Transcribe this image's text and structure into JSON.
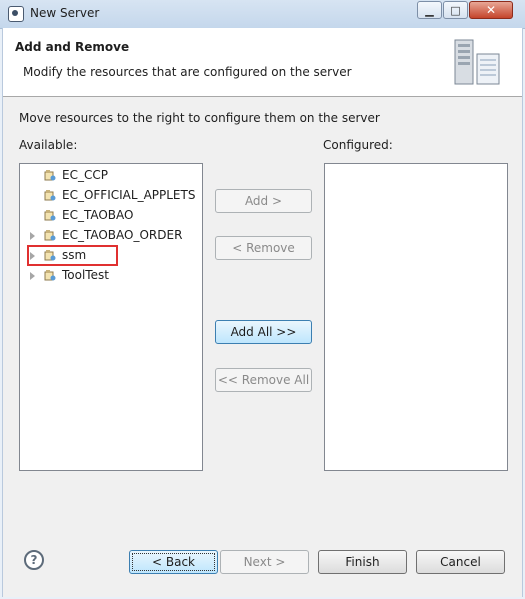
{
  "window": {
    "title": "New Server",
    "minimize_label": "▁",
    "maximize_label": "□",
    "close_label": "✕",
    "app_icon": "eclipse-icon"
  },
  "header": {
    "title": "Add and Remove",
    "subtitle": "Modify the resources that are configured on the server",
    "icon": "server-icon"
  },
  "instruction": "Move resources to the right to configure them on the server",
  "available": {
    "label": "Available:",
    "items": [
      {
        "label": "EC_CCP",
        "expandable": false
      },
      {
        "label": "EC_OFFICIAL_APPLETS",
        "expandable": false
      },
      {
        "label": "EC_TAOBAO",
        "expandable": false
      },
      {
        "label": "EC_TAOBAO_ORDER",
        "expandable": true
      },
      {
        "label": "ssm",
        "expandable": true,
        "highlighted": true
      },
      {
        "label": "ToolTest",
        "expandable": true
      }
    ]
  },
  "configured": {
    "label": "Configured:",
    "items": []
  },
  "buttons": {
    "add": "Add >",
    "remove": "< Remove",
    "add_all": "Add All >>",
    "remove_all": "<< Remove All",
    "back": "< Back",
    "next": "Next >",
    "finish": "Finish",
    "cancel": "Cancel",
    "help": "?"
  },
  "colors": {
    "highlight_border": "#e03030",
    "default_button": "#3c7fb1"
  }
}
